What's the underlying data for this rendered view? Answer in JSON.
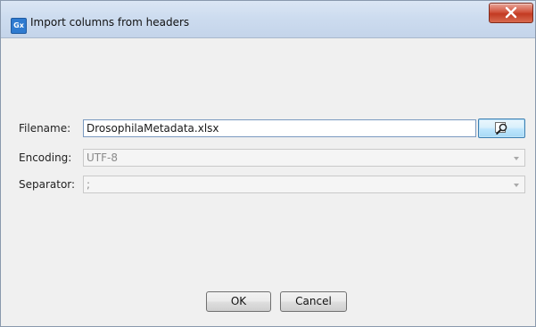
{
  "window": {
    "title": "Import columns from headers",
    "app_icon_text": "Gx",
    "close_symbol": "x"
  },
  "form": {
    "filename": {
      "label": "Filename:",
      "value": "DrosophilaMetadata.xlsx"
    },
    "encoding": {
      "label": "Encoding:",
      "value": "UTF-8"
    },
    "separator": {
      "label": "Separator:",
      "value": ";"
    }
  },
  "buttons": {
    "ok": "OK",
    "cancel": "Cancel"
  },
  "icons": {
    "browse": "magnifier-icon",
    "dropdown": "chevron-down-icon",
    "close": "close-icon"
  }
}
